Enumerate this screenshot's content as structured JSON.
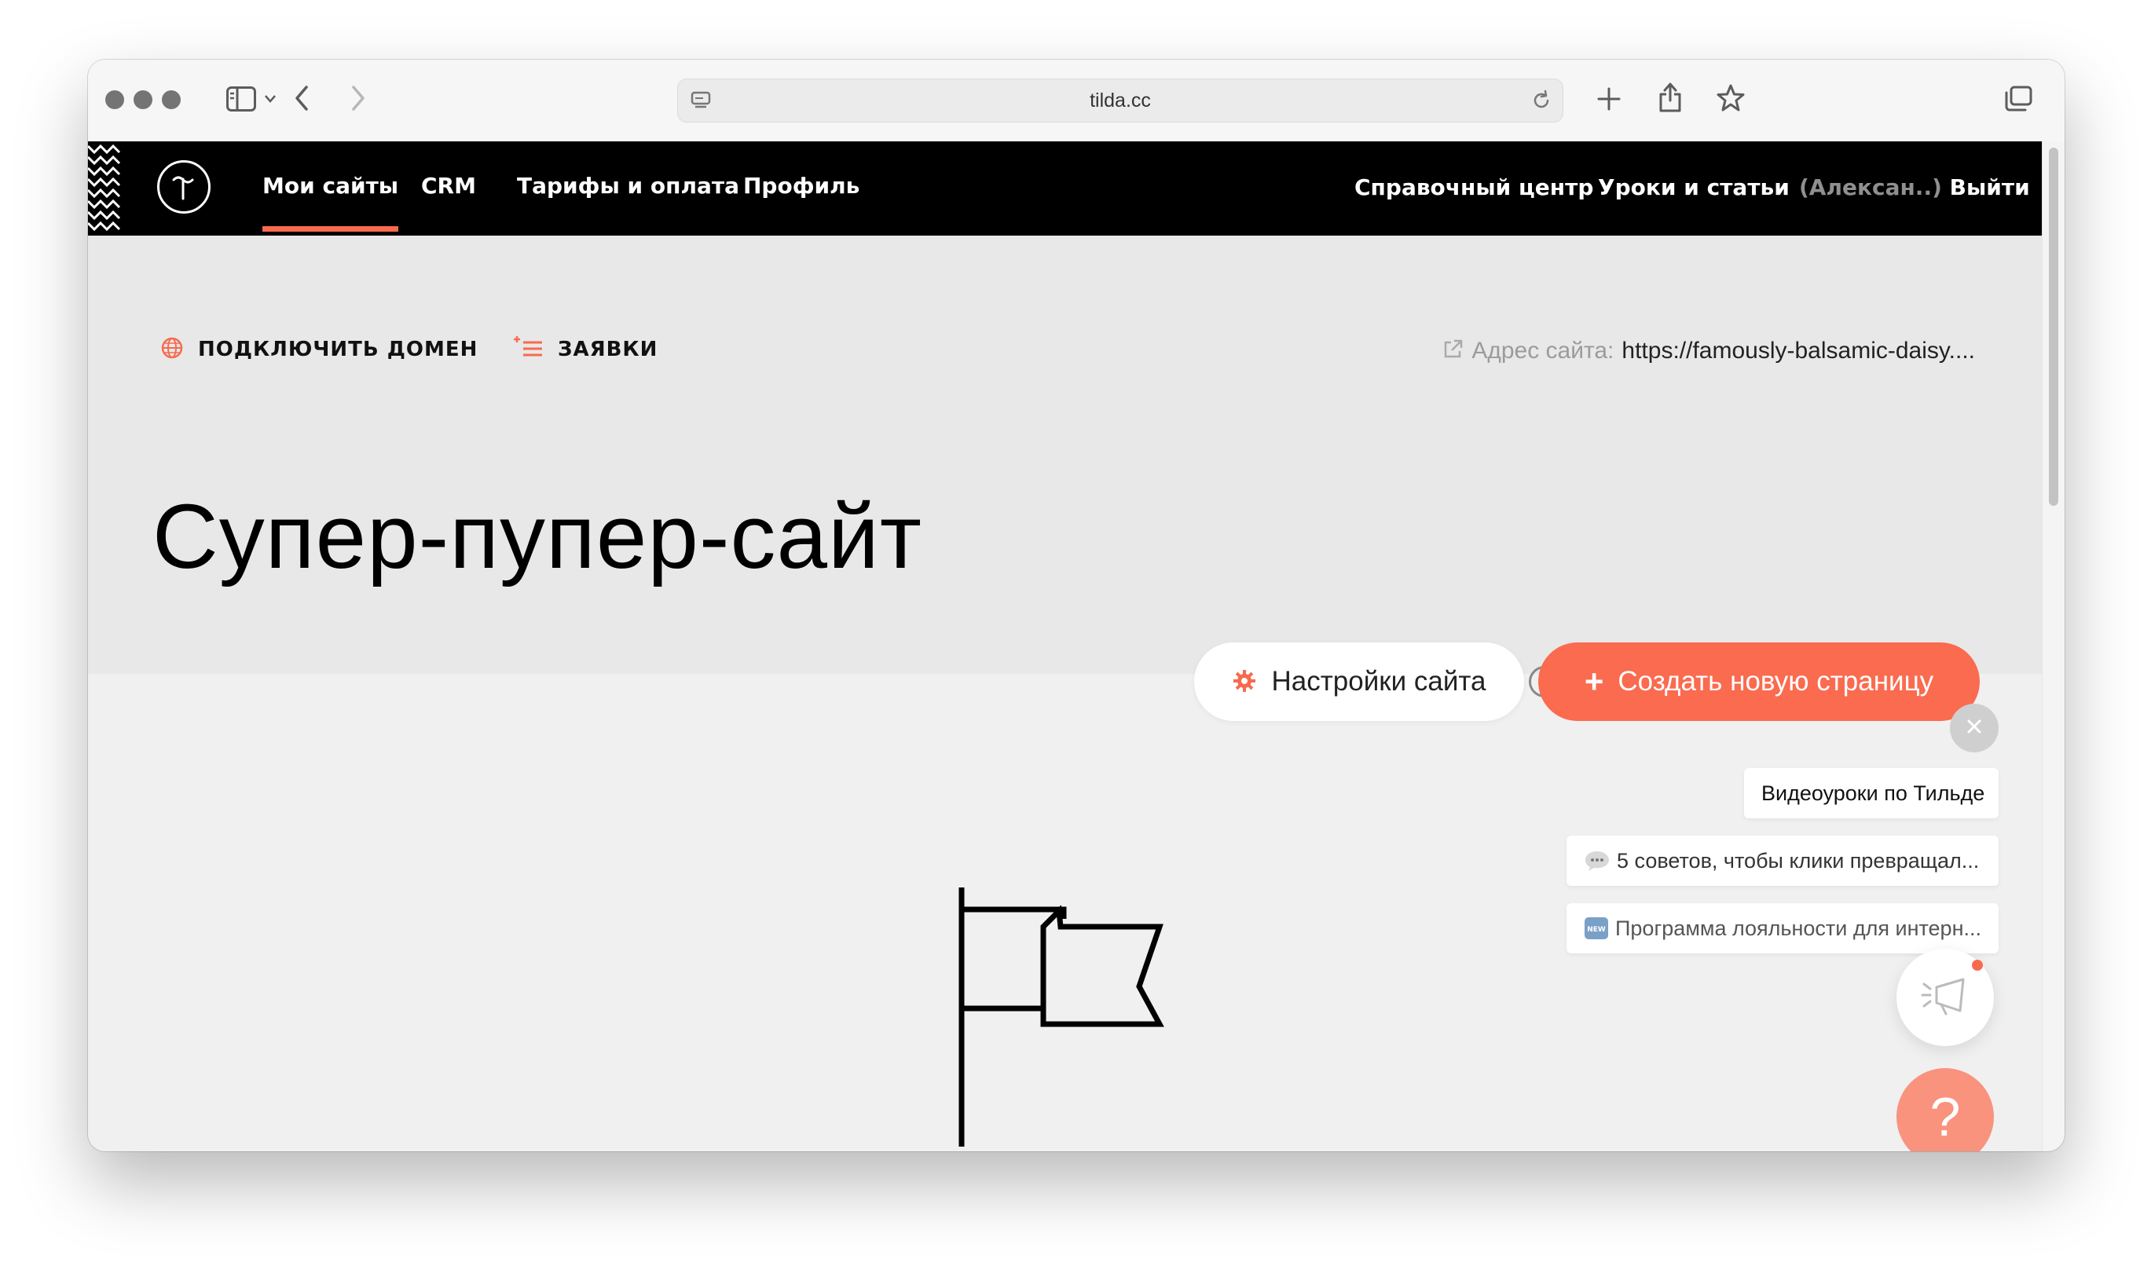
{
  "browser": {
    "url": "tilda.cc"
  },
  "nav": {
    "items": [
      "Мои сайты",
      "CRM",
      "Тарифы и оплата",
      "Профиль"
    ],
    "help_center": "Справочный центр",
    "lessons": "Уроки и статьи",
    "user": "(Алексан..)",
    "logout": "Выйти"
  },
  "hero": {
    "connect_domain": "ПОДКЛЮЧИТЬ ДОМЕН",
    "leads": "ЗАЯВКИ",
    "address_label": "Адрес сайта:",
    "address_value": "https://famously-balsamic-daisy....",
    "site_title": "Супер-пупер-сайт",
    "settings_button": "Настройки сайта",
    "create_button": "Создать новую страницу"
  },
  "widgets": {
    "video_lessons": "Видеоуроки по Тильде",
    "tip1": "5 советов, чтобы клики превращал...",
    "tip2": "Программа лояльности для интерн...",
    "help_symbol": "?"
  },
  "colors": {
    "accent": "#fa6b4f",
    "nav_bg": "#000000",
    "hero_bg": "#e8e8e8",
    "page_bg": "#f0f0f0"
  },
  "icons": [
    "sidebar-icon",
    "chevron-down-icon",
    "back-icon",
    "forward-icon",
    "reload-icon",
    "new-tab-icon",
    "share-icon",
    "bookmark-icon",
    "tabs-icon",
    "globe-icon",
    "leads-icon",
    "external-link-icon",
    "gear-icon",
    "plus-icon",
    "close-icon",
    "speech-bubble-icon",
    "new-badge-icon",
    "megaphone-icon",
    "flag-icon"
  ]
}
